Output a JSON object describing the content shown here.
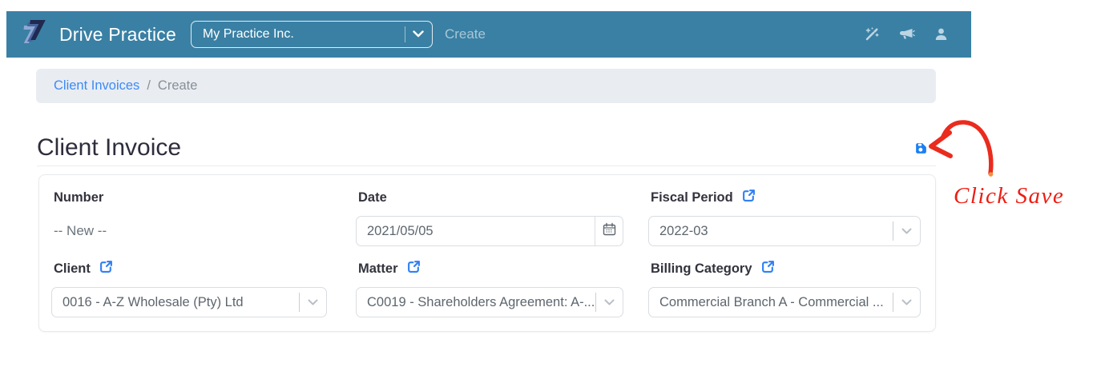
{
  "navbar": {
    "brand": "Drive Practice",
    "practice_selector_value": "My Practice Inc.",
    "active_menu_item": "Create",
    "icons": [
      "wand-icon",
      "megaphone-icon",
      "user-icon"
    ],
    "bg_color": "#3a80a4"
  },
  "breadcrumb": {
    "link": "Client Invoices",
    "separator": "/",
    "current": "Create"
  },
  "page": {
    "title": "Client Invoice",
    "save_icon": "floppy-disk-icon",
    "save_color": "#1b7ff2"
  },
  "form": {
    "fields": {
      "number": {
        "label": "Number",
        "value": "-- New --"
      },
      "date": {
        "label": "Date",
        "value": "2021/05/05",
        "icon": "calendar-icon"
      },
      "fiscal_period": {
        "label": "Fiscal Period",
        "value": "2022-03",
        "icon": "external-link-icon"
      },
      "client": {
        "label": "Client",
        "value": "0016 - A-Z Wholesale (Pty) Ltd",
        "icon": "external-link-icon"
      },
      "matter": {
        "label": "Matter",
        "value": "C0019 - Shareholders Agreement: A-...",
        "icon": "external-link-icon"
      },
      "billing_category": {
        "label": "Billing Category",
        "value": "Commercial Branch A - Commercial ...",
        "icon": "external-link-icon"
      }
    }
  },
  "annotation": {
    "text": "Click Save",
    "color": "#ee1d12"
  },
  "colors": {
    "link_blue": "#3d8af7",
    "accent_blue": "#2f80f6",
    "breadcrumb_bg": "#e9edf1"
  }
}
